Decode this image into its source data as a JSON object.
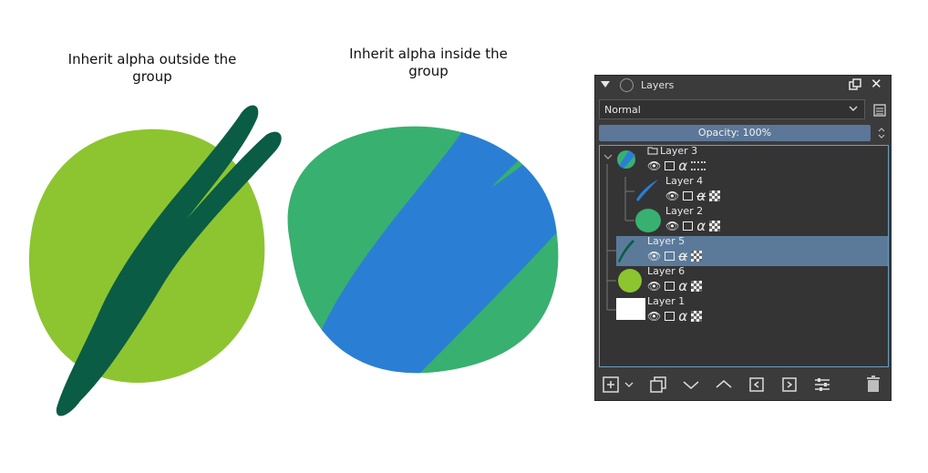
{
  "captions": {
    "left": "Inherit alpha outside the group",
    "right": "Inherit alpha inside the group"
  },
  "docker": {
    "title": "Layers",
    "blend_mode": "Normal",
    "opacity_label": "Opacity:  100%",
    "layers": [
      {
        "name": "Layer 3",
        "type": "group",
        "thumb": "group-thumb"
      },
      {
        "name": "Layer 4",
        "type": "paint",
        "thumb": "blue-stroke-thumb"
      },
      {
        "name": "Layer 2",
        "type": "paint",
        "thumb": "green-blob-thumb"
      },
      {
        "name": "Layer 5",
        "type": "paint",
        "thumb": "dark-stroke-thumb",
        "selected": true
      },
      {
        "name": "Layer 6",
        "type": "paint",
        "thumb": "lime-circle-thumb"
      },
      {
        "name": "Layer 1",
        "type": "paint",
        "thumb": "white-thumb"
      }
    ]
  },
  "colors": {
    "lime": "#8cc530",
    "dark_green": "#0a5c45",
    "teal_green": "#38b070",
    "blue": "#2a7fd4",
    "docker_bg": "#3b3b3b",
    "selection": "#5b7a9a",
    "opacity_bar": "#5c7797"
  }
}
